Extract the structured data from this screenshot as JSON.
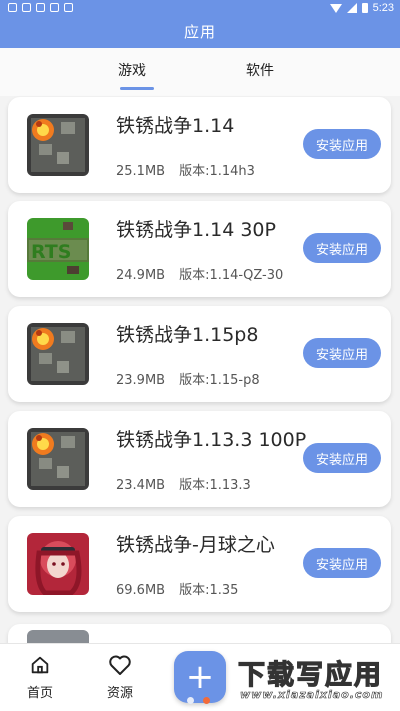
{
  "status_bar": {
    "time": "5:23",
    "left_icons": [
      "notification-icon",
      "app-icon",
      "grid-icon",
      "app-icon",
      "a-icon"
    ]
  },
  "header": {
    "title": "应用"
  },
  "tabs": [
    {
      "label": "游戏",
      "selected": true
    },
    {
      "label": "软件",
      "selected": false
    }
  ],
  "apps": [
    {
      "name": "铁锈战争1.14",
      "size": "25.1MB",
      "version": "版本:1.14h3",
      "button": "安装应用",
      "icon": "rusted-warfare-icon"
    },
    {
      "name": "铁锈战争1.14 30P",
      "size": "24.9MB",
      "version": "版本:1.14-QZ-30",
      "button": "安装应用",
      "icon": "rts-icon"
    },
    {
      "name": "铁锈战争1.15p8",
      "size": "23.9MB",
      "version": "版本:1.15-p8",
      "button": "安装应用",
      "icon": "rusted-warfare-icon"
    },
    {
      "name": "铁锈战争1.13.3 100P",
      "size": "23.4MB",
      "version": "版本:1.13.3",
      "button": "安装应用",
      "icon": "rusted-warfare-icon"
    },
    {
      "name": "铁锈战争-月球之心",
      "size": "69.6MB",
      "version": "版本:1.35",
      "button": "安装应用",
      "icon": "anime-character-icon"
    }
  ],
  "bottom_nav": [
    {
      "label": "首页",
      "icon": "home-icon"
    },
    {
      "label": "资源",
      "icon": "heart-icon"
    }
  ],
  "fab": {
    "symbol": "+"
  },
  "watermark": {
    "main": "下载写应用",
    "sub": "www.xiazaixiao.com"
  },
  "colors": {
    "primary": "#6b93e6",
    "background": "#f3f3f3",
    "card": "#ffffff",
    "accent_dot": "#f26b3a"
  }
}
